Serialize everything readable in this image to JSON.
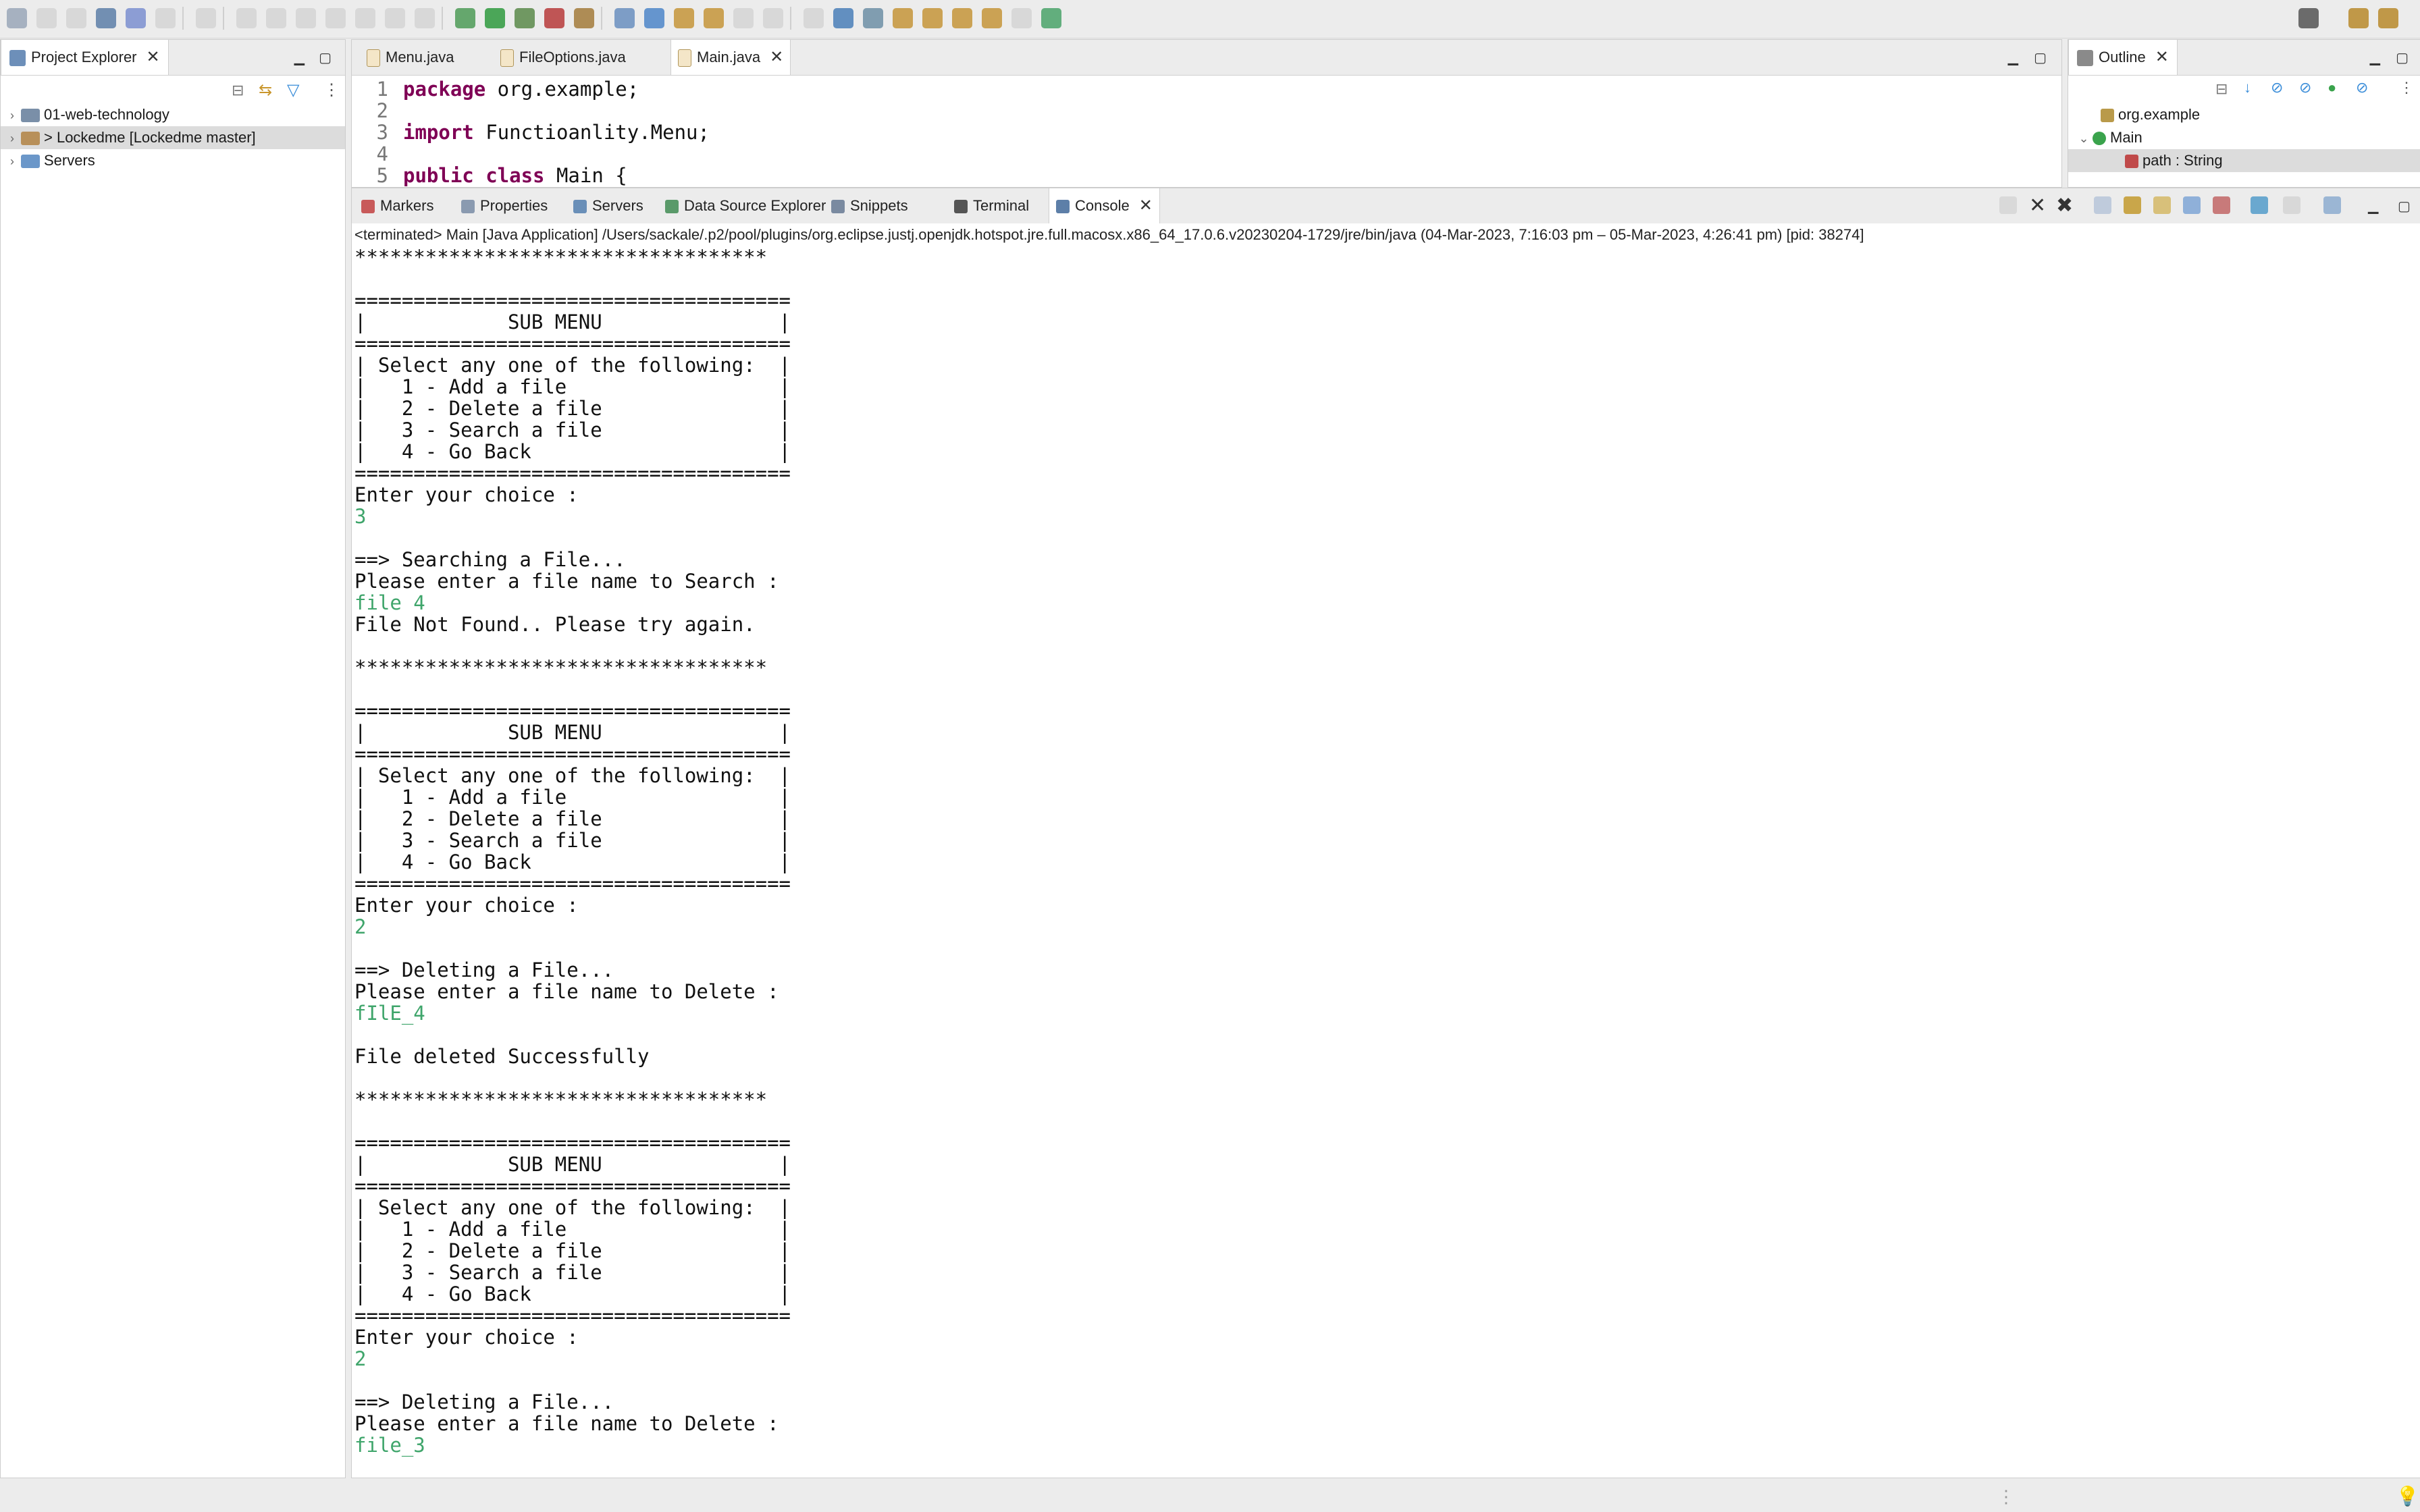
{
  "toolbar": {
    "icons": [
      "new-file",
      "save",
      "save-all",
      "terminal",
      "search-ref",
      "resume",
      "suspend",
      "terminate",
      "disconnect",
      "step-into",
      "step-over",
      "step-return",
      "drop-frame",
      "use-step-filters",
      "debug",
      "run",
      "coverage",
      "run-external",
      "new-java-project",
      "new-package",
      "new-class",
      "open-type",
      "open-task",
      "toggle-mark",
      "annotation",
      "show-whitespace",
      "globe",
      "link",
      "prev-annotation",
      "next-annotation",
      "last-edit",
      "back",
      "forward",
      "pin",
      "search",
      "perspective-java",
      "perspective-debug"
    ]
  },
  "project_explorer": {
    "title": "Project Explorer",
    "items": [
      {
        "label": "01-web-technology",
        "selected": false
      },
      {
        "label": "> Lockedme [Lockedme master]",
        "selected": true
      },
      {
        "label": "Servers",
        "selected": false
      }
    ]
  },
  "editor": {
    "tabs": [
      {
        "label": "Menu.java",
        "active": false
      },
      {
        "label": "FileOptions.java",
        "active": false
      },
      {
        "label": "Main.java",
        "active": true
      }
    ],
    "lines": [
      {
        "num": "1",
        "kw": "package",
        "rest": " org.example;"
      },
      {
        "num": "2",
        "kw": "",
        "rest": ""
      },
      {
        "num": "3",
        "kw": "import",
        "rest": " Functioanlity.Menu;"
      },
      {
        "num": "4",
        "kw": "",
        "rest": ""
      },
      {
        "num": "5",
        "kw": "public class",
        "rest": " Main {"
      }
    ]
  },
  "outline": {
    "title": "Outline",
    "items": [
      {
        "label": "org.example",
        "selected": false
      },
      {
        "label": "Main",
        "selected": false
      },
      {
        "label": "path : String",
        "selected": true
      }
    ]
  },
  "bottom_tabs": [
    {
      "label": "Markers",
      "active": false
    },
    {
      "label": "Properties",
      "active": false
    },
    {
      "label": "Servers",
      "active": false
    },
    {
      "label": "Data Source Explorer",
      "active": false
    },
    {
      "label": "Snippets",
      "active": false
    },
    {
      "label": "Terminal",
      "active": false
    },
    {
      "label": "Console",
      "active": true
    }
  ],
  "console": {
    "header": "<terminated> Main [Java Application] /Users/sackale/.p2/pool/plugins/org.eclipse.justj.openjdk.hotspot.jre.full.macosx.x86_64_17.0.6.v20230204-1729/jre/bin/java  (04-Mar-2023, 7:16:03 pm – 05-Mar-2023, 4:26:41 pm) [pid: 38274]",
    "lines": [
      {
        "text": "***********************************",
        "input": false
      },
      {
        "text": "",
        "input": false
      },
      {
        "text": "=====================================",
        "input": false
      },
      {
        "text": "|            SUB MENU               |",
        "input": false
      },
      {
        "text": "=====================================",
        "input": false
      },
      {
        "text": "| Select any one of the following:  |",
        "input": false
      },
      {
        "text": "|   1 - Add a file                  |",
        "input": false
      },
      {
        "text": "|   2 - Delete a file               |",
        "input": false
      },
      {
        "text": "|   3 - Search a file               |",
        "input": false
      },
      {
        "text": "|   4 - Go Back                     |",
        "input": false
      },
      {
        "text": "=====================================",
        "input": false
      },
      {
        "text": "Enter your choice :",
        "input": false
      },
      {
        "text": "3",
        "input": true
      },
      {
        "text": "",
        "input": false
      },
      {
        "text": "==> Searching a File...",
        "input": false
      },
      {
        "text": "Please enter a file name to Search :",
        "input": false
      },
      {
        "text": "file 4",
        "input": true
      },
      {
        "text": "File Not Found.. Please try again.",
        "input": false
      },
      {
        "text": "",
        "input": false
      },
      {
        "text": "***********************************",
        "input": false
      },
      {
        "text": "",
        "input": false
      },
      {
        "text": "=====================================",
        "input": false
      },
      {
        "text": "|            SUB MENU               |",
        "input": false
      },
      {
        "text": "=====================================",
        "input": false
      },
      {
        "text": "| Select any one of the following:  |",
        "input": false
      },
      {
        "text": "|   1 - Add a file                  |",
        "input": false
      },
      {
        "text": "|   2 - Delete a file               |",
        "input": false
      },
      {
        "text": "|   3 - Search a file               |",
        "input": false
      },
      {
        "text": "|   4 - Go Back                     |",
        "input": false
      },
      {
        "text": "=====================================",
        "input": false
      },
      {
        "text": "Enter your choice :",
        "input": false
      },
      {
        "text": "2",
        "input": true
      },
      {
        "text": "",
        "input": false
      },
      {
        "text": "==> Deleting a File...",
        "input": false
      },
      {
        "text": "Please enter a file name to Delete :",
        "input": false
      },
      {
        "text": "fIlE_4",
        "input": true
      },
      {
        "text": "",
        "input": false
      },
      {
        "text": "File deleted Successfully",
        "input": false
      },
      {
        "text": "",
        "input": false
      },
      {
        "text": "***********************************",
        "input": false
      },
      {
        "text": "",
        "input": false
      },
      {
        "text": "=====================================",
        "input": false
      },
      {
        "text": "|            SUB MENU               |",
        "input": false
      },
      {
        "text": "=====================================",
        "input": false
      },
      {
        "text": "| Select any one of the following:  |",
        "input": false
      },
      {
        "text": "|   1 - Add a file                  |",
        "input": false
      },
      {
        "text": "|   2 - Delete a file               |",
        "input": false
      },
      {
        "text": "|   3 - Search a file               |",
        "input": false
      },
      {
        "text": "|   4 - Go Back                     |",
        "input": false
      },
      {
        "text": "=====================================",
        "input": false
      },
      {
        "text": "Enter your choice :",
        "input": false
      },
      {
        "text": "2",
        "input": true
      },
      {
        "text": "",
        "input": false
      },
      {
        "text": "==> Deleting a File...",
        "input": false
      },
      {
        "text": "Please enter a file name to Delete :",
        "input": false
      },
      {
        "text": "file_3",
        "input": true
      }
    ]
  },
  "colors": {
    "input_text": "#3fa56b",
    "keyword": "#7f0055"
  }
}
